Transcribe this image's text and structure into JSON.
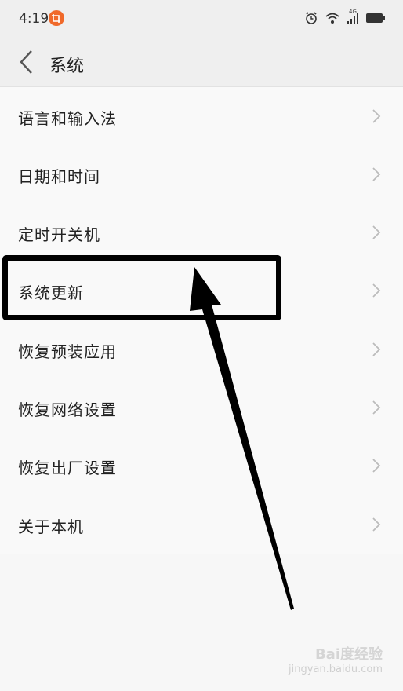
{
  "status_bar": {
    "time": "4:19",
    "network": "4G",
    "icons": [
      "notification-app-icon",
      "alarm-icon",
      "wifi-icon",
      "signal-icon",
      "battery-icon"
    ]
  },
  "header": {
    "title": "系统"
  },
  "settings": {
    "items": [
      {
        "label": "语言和输入法"
      },
      {
        "label": "日期和时间"
      },
      {
        "label": "定时开关机"
      },
      {
        "label": "系统更新"
      },
      {
        "label": "恢复预装应用"
      },
      {
        "label": "恢复网络设置"
      },
      {
        "label": "恢复出厂设置"
      },
      {
        "label": "关于本机"
      }
    ]
  },
  "annotation": {
    "highlighted_item": "系统更新",
    "color": "#000000"
  },
  "watermark": {
    "brand": "Bai度经验",
    "url": "jingyan.baidu.com"
  },
  "colors": {
    "background": "#f7f7f7",
    "header": "#efefef",
    "notification": "#f0692a"
  }
}
